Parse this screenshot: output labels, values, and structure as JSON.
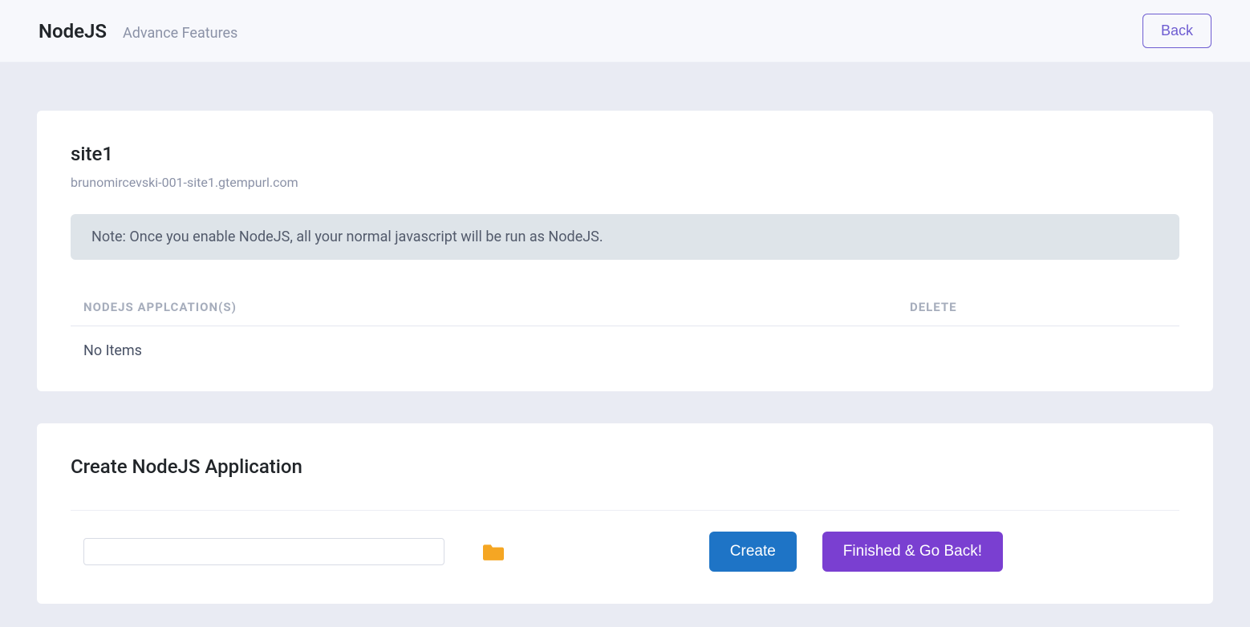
{
  "header": {
    "title": "NodeJS",
    "subtitle": "Advance Features",
    "back_label": "Back"
  },
  "site": {
    "name": "site1",
    "url": "brunomircevski-001-site1.gtempurl.com",
    "note": "Note: Once you enable NodeJS, all your normal javascript will be run as NodeJS."
  },
  "table": {
    "col_name": "NodeJS Applcation(s)",
    "col_delete": "Delete",
    "empty": "No Items"
  },
  "create": {
    "title": "Create NodeJS Application",
    "path_value": "",
    "create_label": "Create",
    "finish_label": "Finished & Go Back!"
  }
}
